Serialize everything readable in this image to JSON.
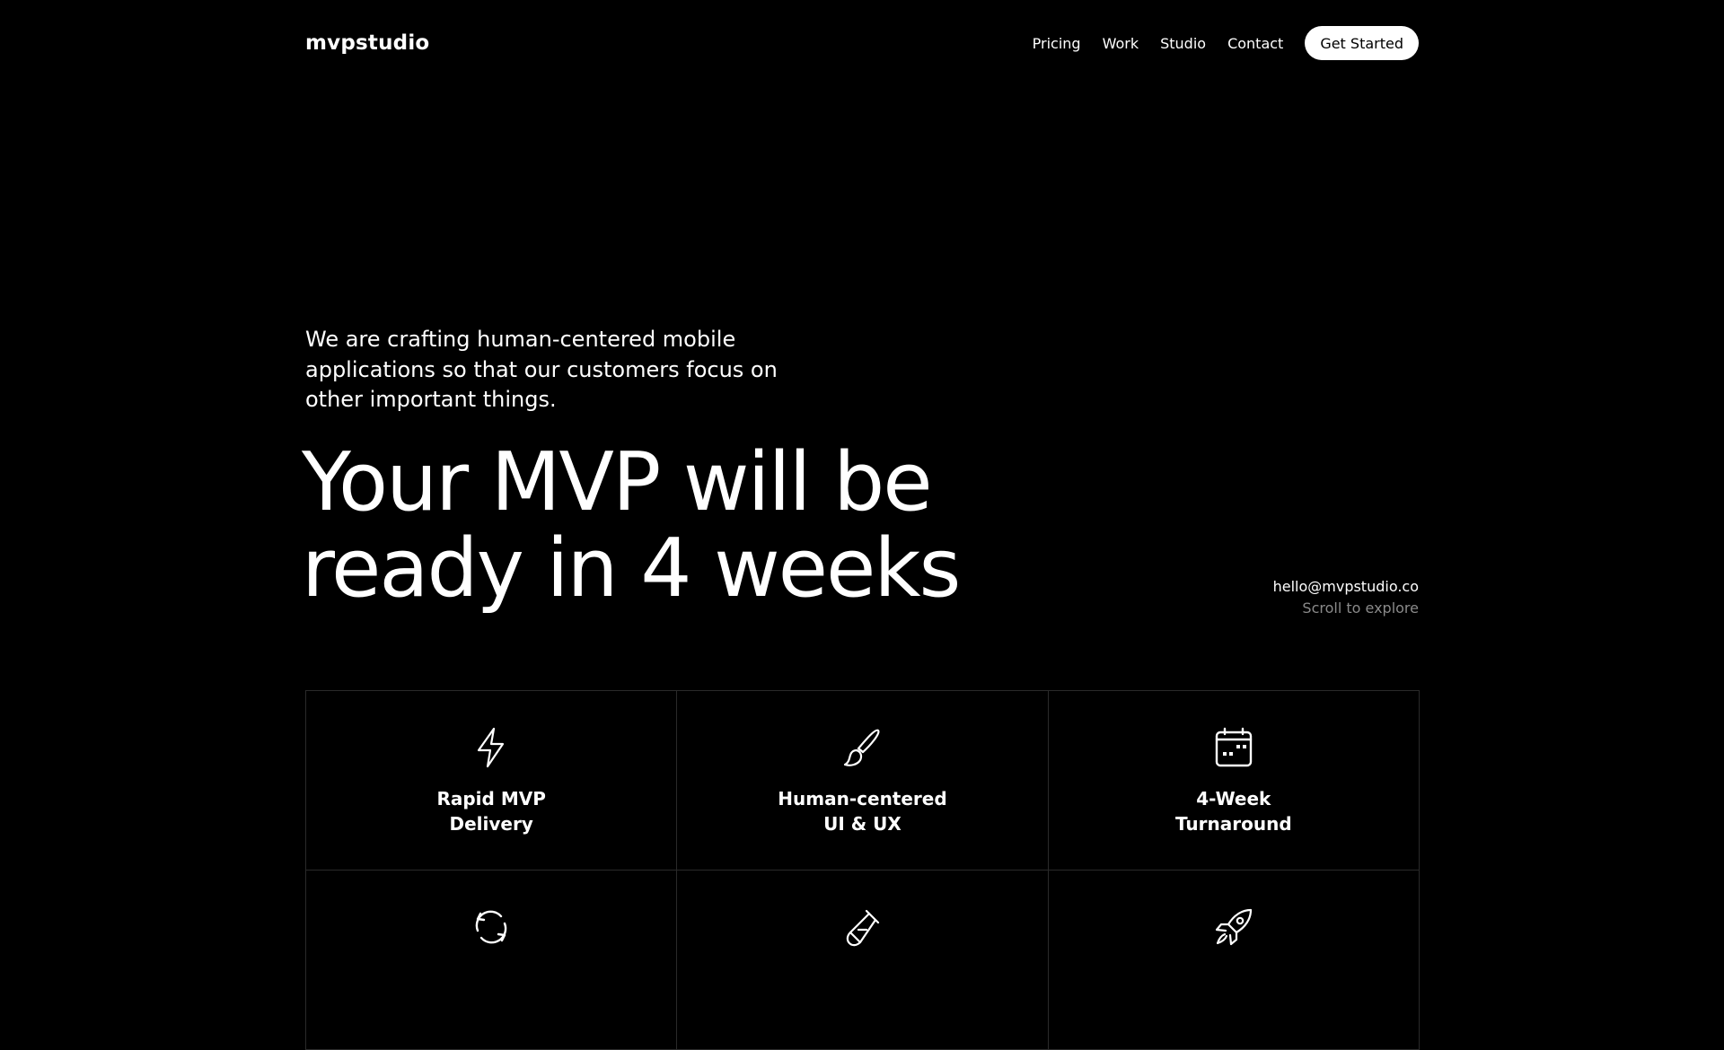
{
  "header": {
    "logo": "mvpstudio",
    "nav": [
      "Pricing",
      "Work",
      "Studio",
      "Contact"
    ],
    "cta": "Get Started"
  },
  "hero": {
    "intro": "We are crafting human-centered mobile applications so that our customers focus on other important things.",
    "title_line_1": "Your MVP will be",
    "title_line_2": "ready in 4 weeks",
    "email": "hello@mvpstudio.co",
    "scroll_hint": "Scroll to explore"
  },
  "features": [
    {
      "icon": "lightning-icon",
      "title_line_1": "Rapid MVP",
      "title_line_2": "Delivery"
    },
    {
      "icon": "paintbrush-icon",
      "title_line_1": "Human-centered",
      "title_line_2": "UI & UX"
    },
    {
      "icon": "calendar-icon",
      "title_line_1": "4-Week",
      "title_line_2": "Turnaround"
    },
    {
      "icon": "refresh-icon",
      "title_line_1": "",
      "title_line_2": ""
    },
    {
      "icon": "test-tube-icon",
      "title_line_1": "",
      "title_line_2": ""
    },
    {
      "icon": "rocket-icon",
      "title_line_1": "",
      "title_line_2": ""
    }
  ],
  "colors": {
    "background": "#000000",
    "text": "#ffffff",
    "muted": "#8a8a8a",
    "border": "#2a2a2a",
    "button_bg": "#ffffff",
    "button_text": "#000000"
  }
}
